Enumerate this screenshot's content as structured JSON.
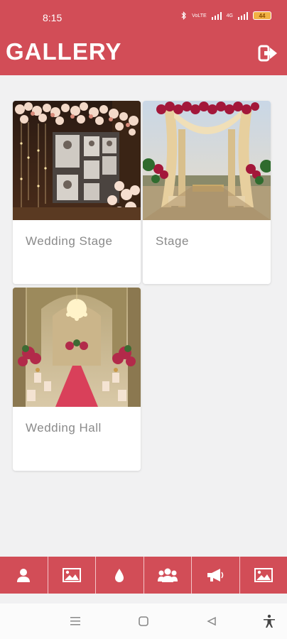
{
  "status": {
    "time": "8:15",
    "battery": "44",
    "net1": "4G",
    "net2": "VoLTE"
  },
  "header": {
    "title": "GALLERY"
  },
  "gallery": {
    "items": [
      {
        "label": "Wedding Stage"
      },
      {
        "label": "Stage"
      },
      {
        "label": "Wedding Hall"
      }
    ]
  },
  "bottom_nav": {
    "icons": [
      "user-icon",
      "image-icon",
      "drop-icon",
      "group-icon",
      "megaphone-icon",
      "image-icon"
    ]
  },
  "colors": {
    "primary": "#d24d57",
    "background": "#f1f1f2",
    "caption": "#8a8a8a"
  }
}
